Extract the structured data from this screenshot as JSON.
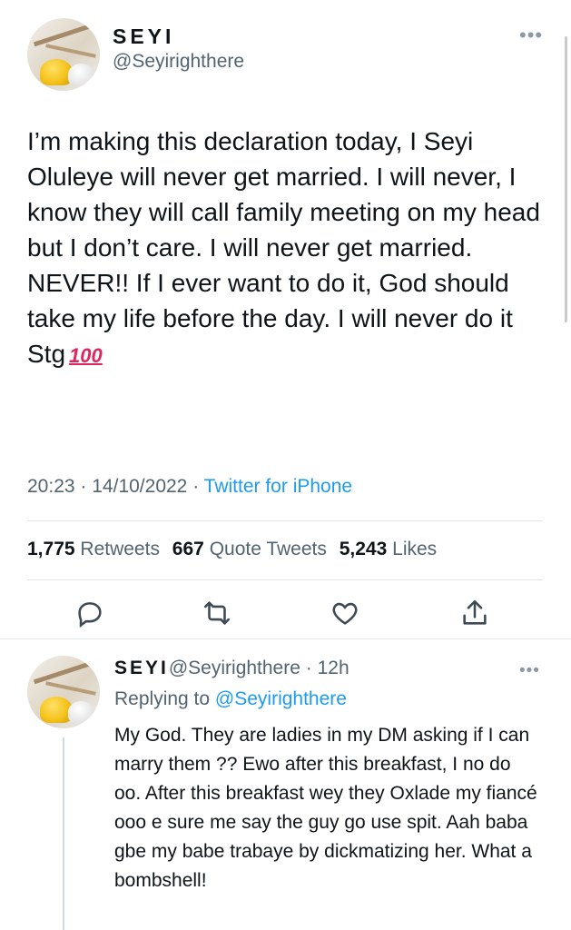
{
  "tweet": {
    "display_name": "SEYI",
    "handle": "@Seyirighthere",
    "more_icon": "•••",
    "text": "I’m making this declaration today, I Seyi Oluleye will never get married. I will never, I know they will call family meeting on my head but I don’t care. I will never get married. NEVER!! If I ever want to do it, God should take my life before the day. I will never do it Stg",
    "emoji": "100",
    "time": "20:23",
    "date": "14/10/2022",
    "source": "Twitter for iPhone",
    "retweets_count": "1,775",
    "retweets_label": "Retweets",
    "quotes_count": "667",
    "quotes_label": "Quote Tweets",
    "likes_count": "5,243",
    "likes_label": "Likes"
  },
  "actions": [
    {
      "name": "reply-icon"
    },
    {
      "name": "retweet-icon"
    },
    {
      "name": "like-icon"
    },
    {
      "name": "share-icon"
    }
  ],
  "reply": {
    "display_name": "SEYI",
    "handle": "@Seyirighthere",
    "time": "12h",
    "replying_prefix": "Replying to",
    "replying_to": "@Seyirighthere",
    "more_icon": "•••",
    "text": "My God. They are ladies in my DM asking if I can marry them ?? Ewo after this breakfast, I no do oo. After this breakfast wey they Oxlade my fiancé ooo e sure me say the guy go use spit. Aah baba gbe my babe trabaye by dickmatizing her. What a bombshell!"
  },
  "colors": {
    "text": "#0f1419",
    "secondary": "#536471",
    "link": "#1d9bf0",
    "divider": "#e2e6e9"
  }
}
